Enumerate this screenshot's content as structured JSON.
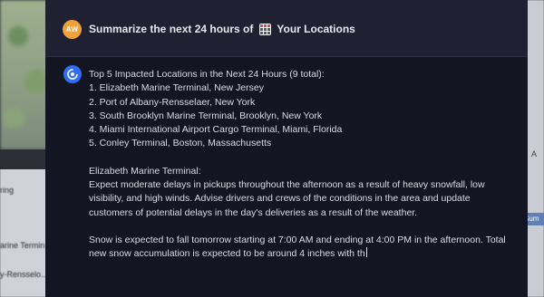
{
  "background": {
    "left_text": [
      "ring",
      "arine Termin..",
      "y-Rensselo..."
    ],
    "right_button": "Sum",
    "right_mark": "A"
  },
  "question": {
    "avatar_initials": "AW",
    "prefix": "Summarize the next 24 hours of",
    "location_label": "Your Locations"
  },
  "response": {
    "heading": "Top 5 Impacted Locations in the Next 24 Hours (9 total):",
    "list": [
      "1. Elizabeth Marine Terminal, New Jersey",
      "2. Port of Albany-Rensselaer, New York",
      "3. South Brooklyn Marine Terminal, Brooklyn, New York",
      "4. Miami International Airport Cargo Terminal, Miami, Florida",
      "5. Conley Terminal, Boston, Massachusetts"
    ],
    "detail_title": "Elizabeth Marine Terminal:",
    "detail_body": "Expect moderate delays in pickups throughout the afternoon as a result of heavy snowfall, low visibility, and high winds. Advise drivers and crews of the conditions in the area and update customers of potential delays in the day's deliveries as a result of the weather.",
    "snow_text": "Snow is expected to fall tomorrow starting at 7:00 AM and ending at 4:00 PM in the afternoon. Total new snow accumulation is expected to be around 4 inches with th"
  },
  "colors": {
    "avatar": "#f0a13a",
    "response_icon": "#2f6df2",
    "modal_bg": "#141522",
    "header_bg": "#1f2031"
  }
}
